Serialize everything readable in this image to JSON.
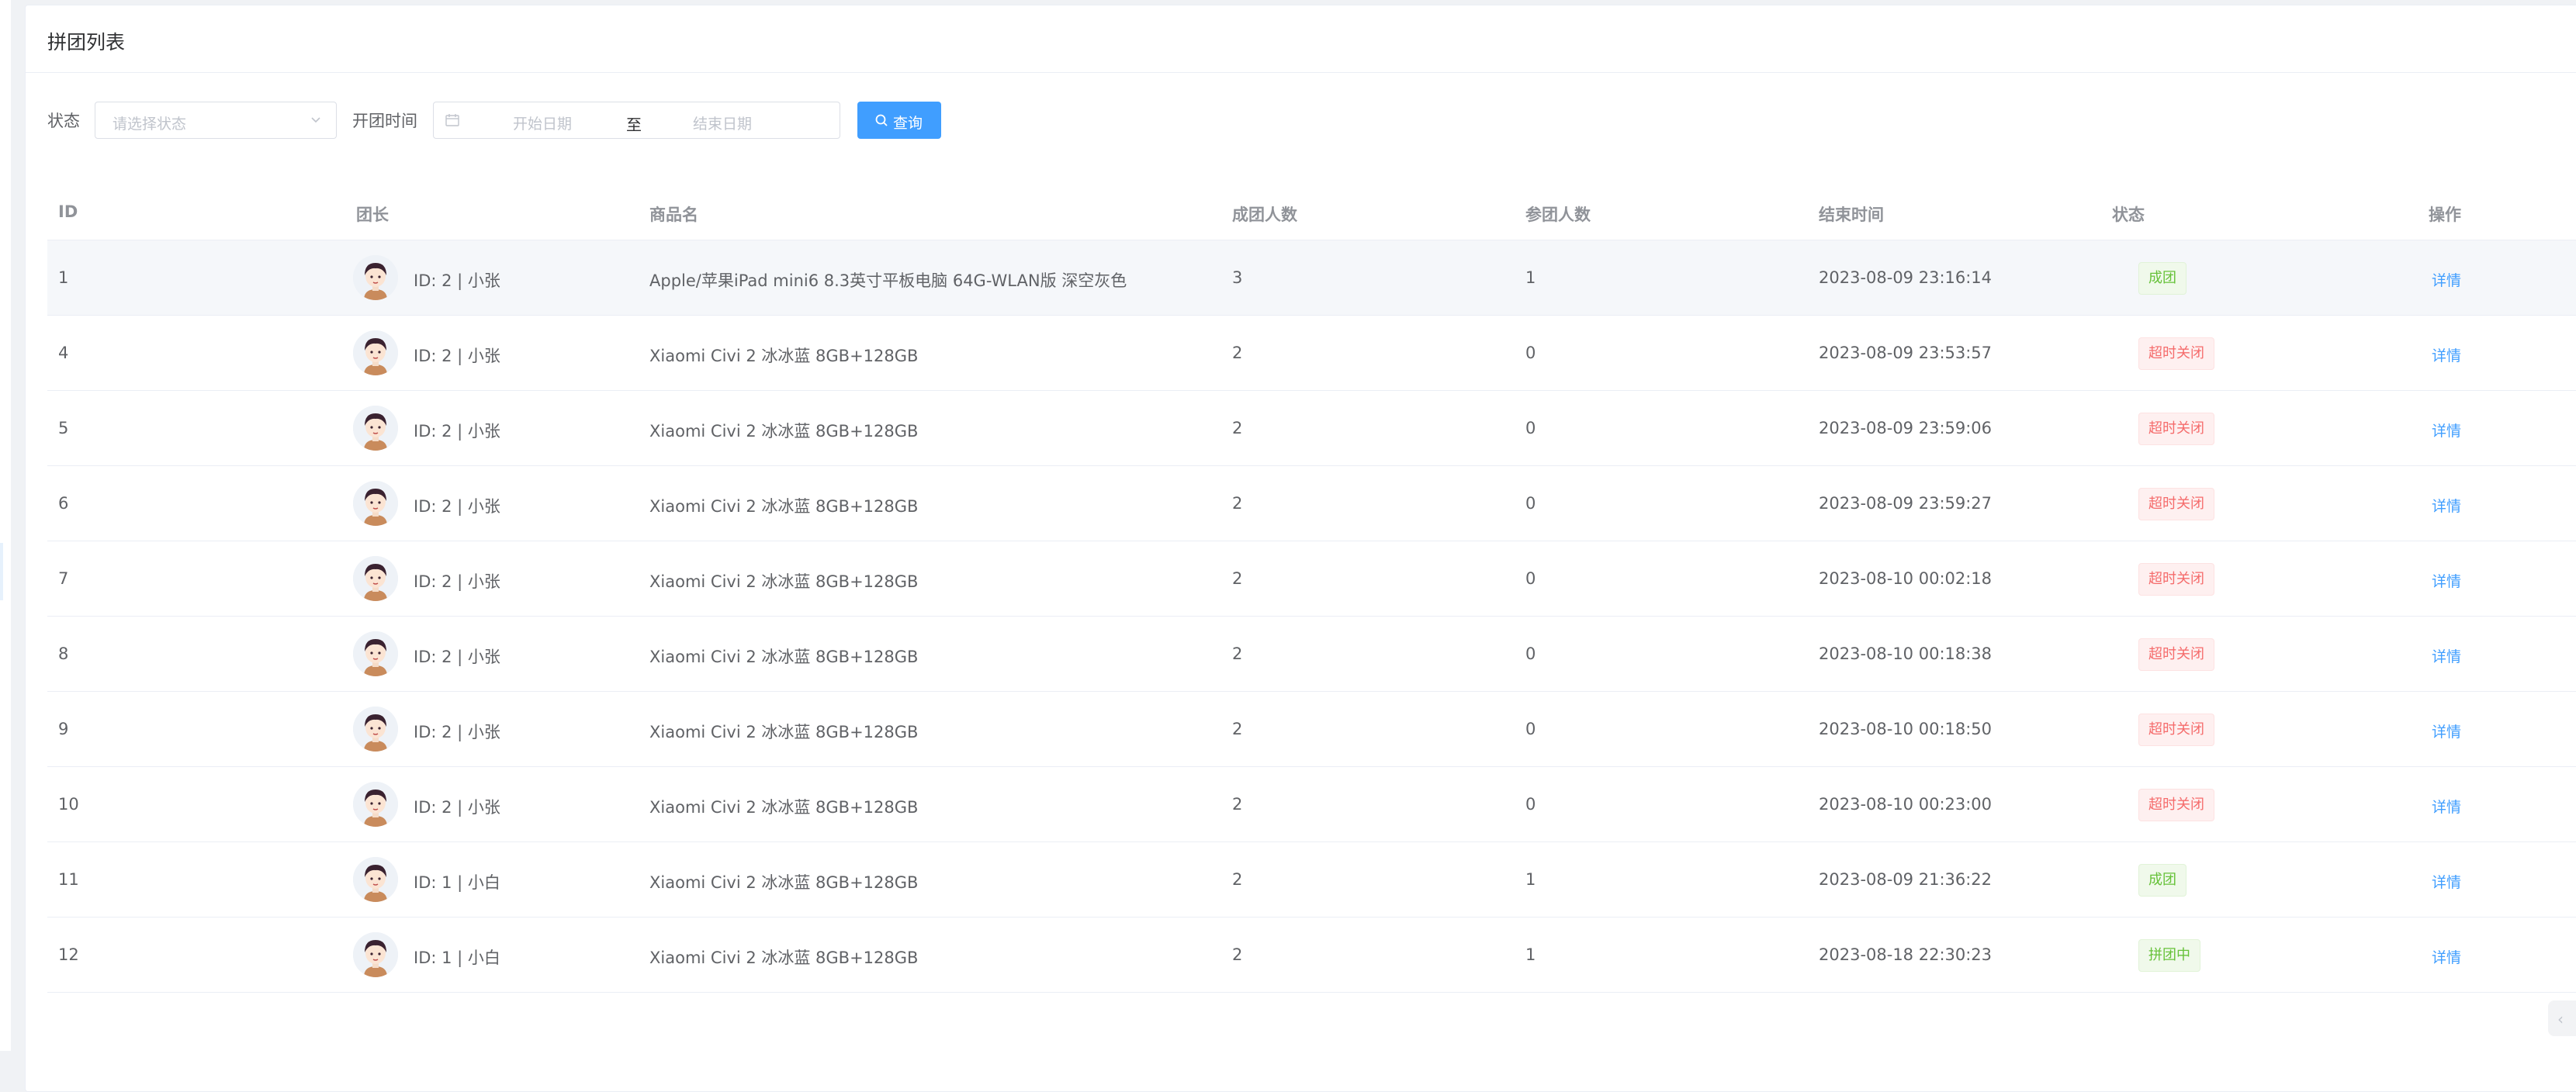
{
  "card": {
    "title": "拼团列表"
  },
  "filters": {
    "status_label": "状态",
    "status_placeholder": "请选择状态",
    "time_label": "开团时间",
    "start_placeholder": "开始日期",
    "range_separator": "至",
    "end_placeholder": "结束日期",
    "query_button": "查询"
  },
  "table": {
    "columns": [
      "ID",
      "团长",
      "商品名",
      "成团人数",
      "参团人数",
      "结束时间",
      "状态",
      "操作"
    ],
    "rows": [
      {
        "id": "1",
        "leader": "ID: 2 | 小张",
        "product": "Apple/苹果iPad mini6 8.3英寸平板电脑 64G-WLAN版 深空灰色",
        "group_size": "3",
        "joined": "1",
        "end_time": "2023-08-09 23:16:14",
        "status": "成团",
        "status_type": "success",
        "action": "详情"
      },
      {
        "id": "4",
        "leader": "ID: 2 | 小张",
        "product": "Xiaomi Civi 2 冰冰蓝 8GB+128GB",
        "group_size": "2",
        "joined": "0",
        "end_time": "2023-08-09 23:53:57",
        "status": "超时关闭",
        "status_type": "danger",
        "action": "详情"
      },
      {
        "id": "5",
        "leader": "ID: 2 | 小张",
        "product": "Xiaomi Civi 2 冰冰蓝 8GB+128GB",
        "group_size": "2",
        "joined": "0",
        "end_time": "2023-08-09 23:59:06",
        "status": "超时关闭",
        "status_type": "danger",
        "action": "详情"
      },
      {
        "id": "6",
        "leader": "ID: 2 | 小张",
        "product": "Xiaomi Civi 2 冰冰蓝 8GB+128GB",
        "group_size": "2",
        "joined": "0",
        "end_time": "2023-08-09 23:59:27",
        "status": "超时关闭",
        "status_type": "danger",
        "action": "详情"
      },
      {
        "id": "7",
        "leader": "ID: 2 | 小张",
        "product": "Xiaomi Civi 2 冰冰蓝 8GB+128GB",
        "group_size": "2",
        "joined": "0",
        "end_time": "2023-08-10 00:02:18",
        "status": "超时关闭",
        "status_type": "danger",
        "action": "详情"
      },
      {
        "id": "8",
        "leader": "ID: 2 | 小张",
        "product": "Xiaomi Civi 2 冰冰蓝 8GB+128GB",
        "group_size": "2",
        "joined": "0",
        "end_time": "2023-08-10 00:18:38",
        "status": "超时关闭",
        "status_type": "danger",
        "action": "详情"
      },
      {
        "id": "9",
        "leader": "ID: 2 | 小张",
        "product": "Xiaomi Civi 2 冰冰蓝 8GB+128GB",
        "group_size": "2",
        "joined": "0",
        "end_time": "2023-08-10 00:18:50",
        "status": "超时关闭",
        "status_type": "danger",
        "action": "详情"
      },
      {
        "id": "10",
        "leader": "ID: 2 | 小张",
        "product": "Xiaomi Civi 2 冰冰蓝 8GB+128GB",
        "group_size": "2",
        "joined": "0",
        "end_time": "2023-08-10 00:23:00",
        "status": "超时关闭",
        "status_type": "danger",
        "action": "详情"
      },
      {
        "id": "11",
        "leader": "ID: 1 | 小白",
        "product": "Xiaomi Civi 2 冰冰蓝 8GB+128GB",
        "group_size": "2",
        "joined": "1",
        "end_time": "2023-08-09 21:36:22",
        "status": "成团",
        "status_type": "success",
        "action": "详情"
      },
      {
        "id": "12",
        "leader": "ID: 1 | 小白",
        "product": "Xiaomi Civi 2 冰冰蓝 8GB+128GB",
        "group_size": "2",
        "joined": "1",
        "end_time": "2023-08-18 22:30:23",
        "status": "拼团中",
        "status_type": "success",
        "action": "详情"
      }
    ]
  },
  "colors": {
    "primary": "#409eff",
    "success": "#67c23a",
    "danger": "#f56c6c"
  },
  "icons": {
    "select_arrow": "chevron-down-icon",
    "date": "calendar-icon",
    "query": "search-icon",
    "avatar": "avatar-icon",
    "scroll": "chevron-left-icon"
  }
}
